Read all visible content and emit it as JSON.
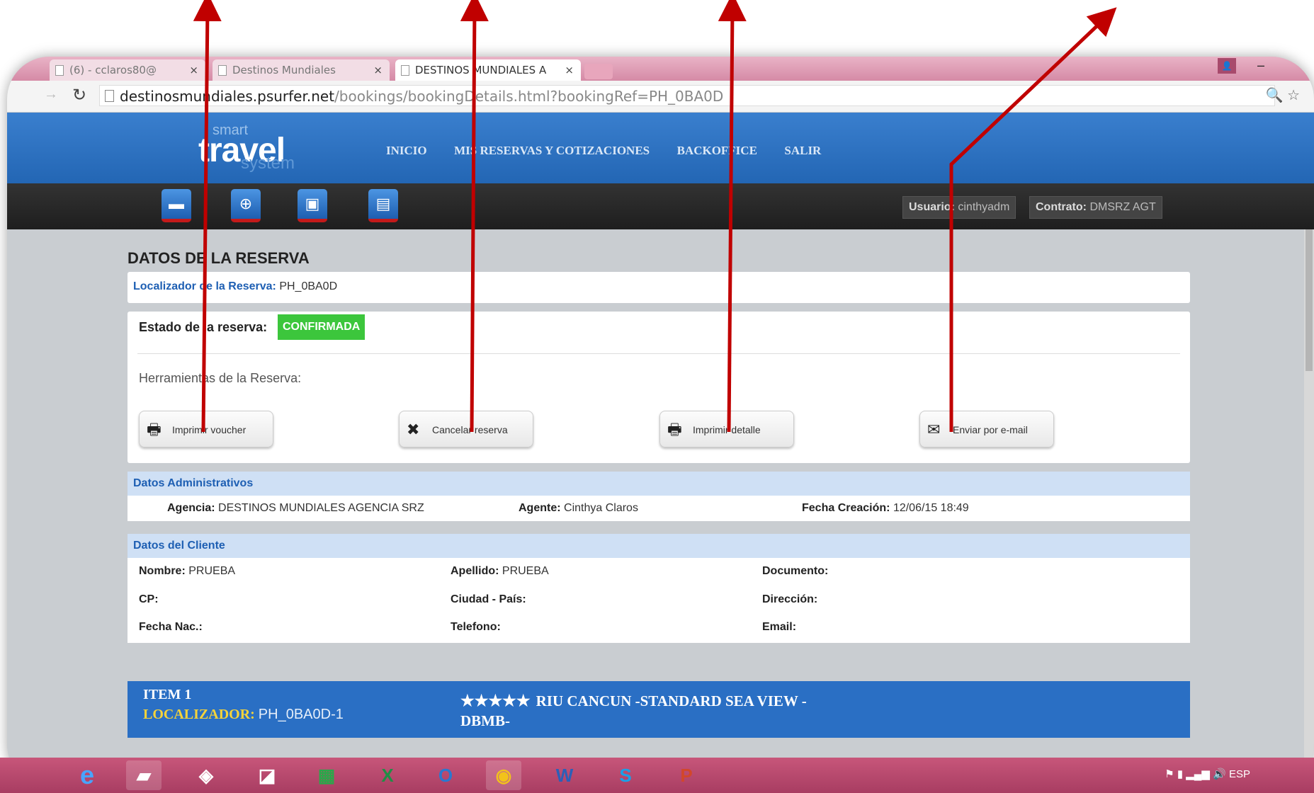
{
  "browser": {
    "tabs": [
      {
        "label": "(6) - cclaros80@"
      },
      {
        "label": "Destinos Mundiales"
      },
      {
        "label": "DESTINOS MUNDIALES A"
      }
    ],
    "url_host": "destinosmundiales.psurfer.net",
    "url_path": "/bookings/bookingDetails.html?bookingRef=PH_0BA0D"
  },
  "site": {
    "logo": {
      "smart": "smart",
      "travel": "travel",
      "system": "system"
    },
    "nav": [
      "INICIO",
      "MIS RESERVAS Y COTIZACIONES",
      "BACKOFFICE",
      "SALIR"
    ],
    "product_icons": [
      "hotel-icon",
      "add-icon",
      "bus-icon",
      "package-icon"
    ],
    "user_label": "Usuario:",
    "user_value": "cinthyadm",
    "contract_label": "Contrato:",
    "contract_value": "DMSRZ AGT"
  },
  "booking": {
    "title": "DATOS DE LA RESERVA",
    "locator_label": "Localizador de la Reserva:",
    "locator_value": "PH_0BA0D",
    "status_label": "Estado de la reserva:",
    "status_value": "CONFIRMADA",
    "tools_label": "Herramientas de la Reserva:",
    "tools": [
      "Imprimir voucher",
      "Cancelar reserva",
      "Imprimir detalle",
      "Enviar por e-mail"
    ]
  },
  "admin": {
    "heading": "Datos Administrativos",
    "agency_label": "Agencia:",
    "agency_value": "DESTINOS MUNDIALES AGENCIA SRZ",
    "agent_label": "Agente:",
    "agent_value": "Cinthya Claros",
    "created_label": "Fecha Creación:",
    "created_value": "12/06/15 18:49"
  },
  "client": {
    "heading": "Datos del Cliente",
    "name_label": "Nombre:",
    "name_value": "PRUEBA",
    "surname_label": "Apellido:",
    "surname_value": "PRUEBA",
    "document_label": "Documento:",
    "cp_label": "CP:",
    "city_label": "Ciudad - País:",
    "address_label": "Dirección:",
    "birth_label": "Fecha Nac.:",
    "phone_label": "Telefono:",
    "email_label": "Email:"
  },
  "item": {
    "title": "ITEM 1",
    "locator_label": "LOCALIZADOR:",
    "locator_value": "PH_0BA0D-1",
    "stars": "★★★★★",
    "hotel": "RIU CANCUN -STANDARD SEA VIEW - DBMB-"
  },
  "taskbar": {
    "apps": [
      "ie-icon",
      "explorer-icon",
      "app-icon",
      "app-icon-2",
      "store-icon",
      "excel-icon",
      "outlook-icon",
      "chrome-icon",
      "word-icon",
      "skype-icon",
      "powerpoint-icon"
    ],
    "lang": "ESP"
  },
  "colors": {
    "header_blue": "#2a6fc4",
    "status_green": "#3cc63c",
    "arrow_red": "#c00000",
    "taskbar": "#b84a70"
  }
}
